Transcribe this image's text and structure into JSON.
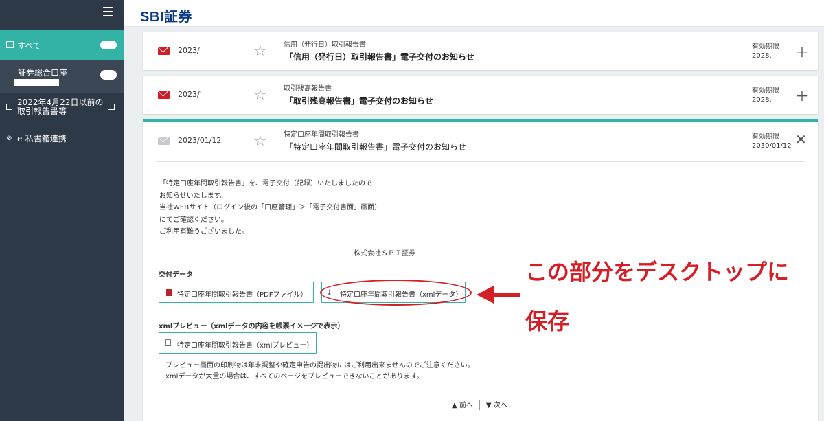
{
  "sidebar": {
    "items": [
      {
        "label": "すべて"
      },
      {
        "label": "証券総合口座"
      },
      {
        "label_line1": "2022年4月22日以前の",
        "label_line2": "取引報告書等"
      },
      {
        "label": "e-私書箱連携"
      }
    ]
  },
  "header": {
    "logo": "SBI証券"
  },
  "messages": [
    {
      "date": "2023/",
      "category": "信用（発行日）取引報告書",
      "title": "「信用（発行日）取引報告書」電子交付のお知らせ",
      "expiry_label": "有効期限",
      "expiry": "2028,",
      "star": "☆",
      "action": "＋"
    },
    {
      "date": "2023/'",
      "category": "取引残高報告書",
      "title": "「取引残高報告書」電子交付のお知らせ",
      "expiry_label": "有効期限",
      "expiry": "2028,",
      "star": "☆",
      "action": "＋"
    },
    {
      "date": "2023/01/12",
      "category": "特定口座年間取引報告書",
      "title": "「特定口座年間取引報告書」電子交付のお知らせ",
      "expiry_label": "有効期限",
      "expiry": "2030/01/12",
      "star": "☆",
      "action": "✕"
    }
  ],
  "detail": {
    "body_lines": [
      "「特定口座年間取引報告書」を、電子交付（記録）いたしましたので",
      "お知らせいたします。",
      "当社WEBサイト（ログイン後の「口座管理」＞「電子交付書面」画面）",
      "にてご確認ください。",
      "ご利用有難うございました。"
    ],
    "company": "株式会社ＳＢＩ証券",
    "delivery_label": "交付データ",
    "pdf_button": "特定口座年間取引報告書（PDFファイル）",
    "xml_button": "特定口座年間取引報告書（xmlデータ）",
    "preview_label": "xmlプレビュー（xmlデータの内容を帳票イメージで表示）",
    "preview_button": "特定口座年間取引報告書（xmlプレビュー）",
    "notes": [
      "プレビュー画面の印刷物は年末調整や確定申告の提出物にはご利用出来ませんのでご注意ください。",
      "xmlデータが大量の場合は、すべてのページをプレビューできないことがあります。"
    ],
    "prev": "▲ 前へ",
    "next": "▼ 次へ"
  },
  "annotation": {
    "line1": "この部分をデスクトップに",
    "line2": "保存",
    "color": "#d31f25"
  },
  "colors": {
    "sidebar_bg": "#2d3946",
    "accent": "#33b3a6",
    "brand": "#0a3b82",
    "mail_red": "#d11d25"
  }
}
